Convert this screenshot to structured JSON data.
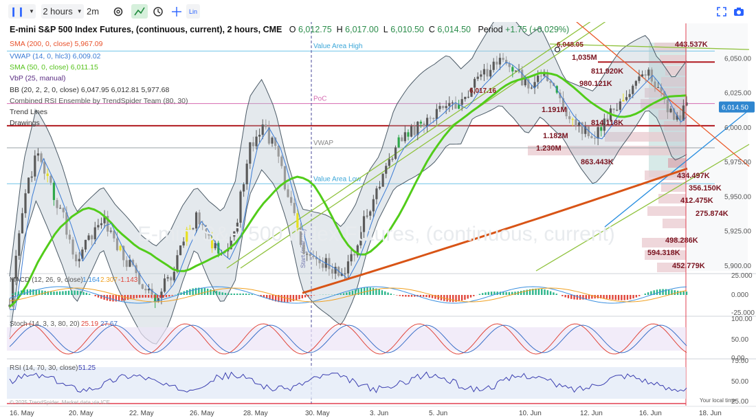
{
  "toolbar": {
    "chart_type_icon": "candlestick-icon",
    "interval": "2 hours",
    "interval_alt": "2m",
    "settings_icon": "gear-icon",
    "crosshair_icon": "crosshair-icon",
    "clock_icon": "clock-icon",
    "lin_label": "Lin",
    "fullscreen_icon": "fullscreen-icon",
    "camera_icon": "camera-icon"
  },
  "header": {
    "title": "E-mini S&P 500 Index Futures, (continuous, current), 2 hours, CME",
    "o_label": "O",
    "o_value": "6,012.75",
    "h_label": "H",
    "h_value": "6,017.00",
    "l_label": "L",
    "l_value": "6,010.50",
    "c_label": "C",
    "c_value": "6,014.50",
    "period_label": "Period",
    "period_value": "+1.75 (+0.029%)"
  },
  "legend": [
    {
      "label": "SMA (200, 0, close)",
      "value": "5,967.09",
      "color": "#e8502a"
    },
    {
      "label": "VWAP (14, 0, hlc3)",
      "value": "6,009.02",
      "color": "#3a7bd5"
    },
    {
      "label": "SMA (50, 0, close)",
      "value": "6,011.15",
      "color": "#55c21b"
    },
    {
      "label": "VbP (25, manual)",
      "value": "",
      "color": "#5a2d82"
    },
    {
      "label": "BB (20, 2, 2, 0, close)",
      "value": "6,047.95 6,012.81 5,977.68",
      "color": "#333333"
    },
    {
      "label": "Combined RSI Ensemble by TrendSpider Team (80, 30)",
      "value": "",
      "color": "#555555"
    },
    {
      "label": "Trend Lines",
      "value": "",
      "color": "#333333"
    },
    {
      "label": "Drawings",
      "value": "",
      "color": "#333333"
    }
  ],
  "price_panel": {
    "last_price": "6,014.50",
    "level_labels": [
      "Value Area High",
      "PoC",
      "VWAP",
      "Value Area Low"
    ],
    "annotations": [
      "6,048.05",
      "6,017.16",
      "1,035M",
      "980.121K",
      "811.920K",
      "1.191M",
      "814.118K",
      "1.182M",
      "1.230M",
      "863.443K",
      "443.537K",
      "434.497K",
      "356.150K",
      "412.475K",
      "275.874K",
      "498.286K",
      "594.318K",
      "452.779K"
    ],
    "vertical_line_label": "Start (manual)"
  },
  "macd": {
    "label": "MACD (12, 26, 9, close)",
    "v1": "1.164",
    "v2": "2.307",
    "v3": "-1.143"
  },
  "stoch": {
    "label": "Stoch (14, 3, 3, 80, 20)",
    "v1": "25.19",
    "v2": "27.67"
  },
  "rsi": {
    "label": "RSI (14, 70, 30, close)",
    "v1": "51.25"
  },
  "footer": {
    "copyright": "© 2025 TrendSpider. Market data via ICE",
    "local_time": "Your local time"
  },
  "chart_data": {
    "type": "candlestick",
    "symbol": "E-mini S&P 500 Index Futures, (continuous, current), 2 hours, CME",
    "y_ticks": [
      "6,050.00",
      "6,025.00",
      "6,000.00",
      "5,975.00",
      "5,950.00",
      "5,925.00",
      "5,900.00"
    ],
    "ylim": [
      5895,
      6075
    ],
    "x_ticks": [
      "16. May",
      "20. May",
      "22. May",
      "26. May",
      "28. May",
      "30. May",
      "3. Jun",
      "5. Jun",
      "10. Jun",
      "12. Jun",
      "16. Jun",
      "18. Jun"
    ],
    "close_path": [
      5870,
      5945,
      5980,
      5960,
      5935,
      5905,
      5920,
      5935,
      5915,
      5900,
      5885,
      5878,
      5890,
      5915,
      5935,
      5918,
      5905,
      5925,
      5985,
      6002,
      5985,
      5950,
      5912,
      5905,
      5900,
      5892,
      5910,
      5940,
      5960,
      5985,
      5995,
      6003,
      6010,
      6020,
      6015,
      6030,
      6040,
      6050,
      6042,
      6030,
      6040,
      6025,
      6010,
      6000,
      5992,
      6005,
      6020,
      6030,
      6040,
      6025,
      6005,
      6014
    ],
    "horizontal_levels": {
      "value_area_high": 6055,
      "poc": 6017,
      "vwap": 5985,
      "value_area_low": 5959,
      "red_line_1": 6047,
      "red_line_2": 6001
    },
    "macd": {
      "ylim": [
        -25,
        25
      ],
      "ticks": [
        "25.000",
        "0.000",
        "-25.000"
      ]
    },
    "stoch": {
      "ylim": [
        0,
        100
      ],
      "ticks": [
        "100.00",
        "50.00",
        "0.00"
      ],
      "bands": [
        20,
        80
      ]
    },
    "rsi": {
      "ylim": [
        0,
        100
      ],
      "ticks": [
        "75.00",
        "50.00",
        "25.00"
      ],
      "bands": [
        30,
        70
      ]
    }
  }
}
